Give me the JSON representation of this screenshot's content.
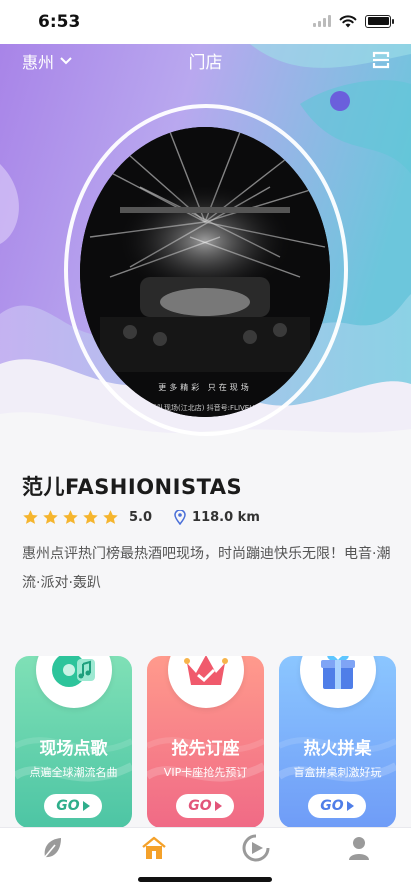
{
  "status_bar": {
    "time": "6:53"
  },
  "header": {
    "city": "惠州",
    "title": "门店"
  },
  "hero": {
    "photo_caption_line1": "更多精彩 只在现场",
    "photo_caption_line2": "范儿乐队现场(江北店) 抖音号:FLIVEHOUSE"
  },
  "venue": {
    "name": "范儿FASHIONISTAS",
    "rating": "5.0",
    "rating_value": 5,
    "distance": "118.0 km",
    "description": "惠州点评热门榜最热酒吧现场，时尚蹦迪快乐无限！电音·潮流·派对·轰趴"
  },
  "cards": [
    {
      "title": "现场点歌",
      "subtitle": "点遍全球潮流名曲",
      "go_label": "GO",
      "icon": "vinyl-music-icon",
      "color": "#2fae8b"
    },
    {
      "title": "抢先订座",
      "subtitle": "VIP卡座抢先预订",
      "go_label": "GO",
      "icon": "crown-icon",
      "color": "#e2557a"
    },
    {
      "title": "热火拼桌",
      "subtitle": "盲盒拼桌刺激好玩",
      "go_label": "GO",
      "icon": "gift-box-icon",
      "color": "#4f7ee8"
    }
  ],
  "tabbar": {
    "items": [
      {
        "icon": "leaf-icon",
        "active": false
      },
      {
        "icon": "home-icon",
        "active": true
      },
      {
        "icon": "play-circle-icon",
        "active": false
      },
      {
        "icon": "profile-icon",
        "active": false
      }
    ],
    "active_color": "#f4a12a",
    "inactive_color": "#9a9a9a"
  }
}
